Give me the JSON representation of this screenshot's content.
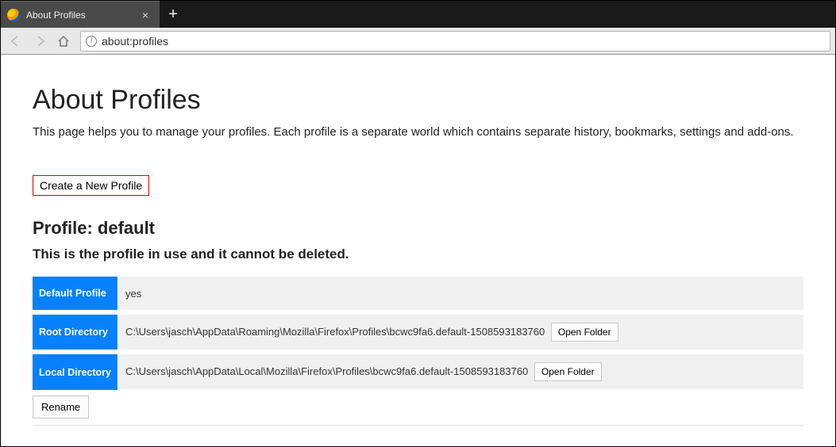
{
  "browser": {
    "tab_title": "About Profiles",
    "url": "about:profiles"
  },
  "page": {
    "heading": "About Profiles",
    "intro": "This page helps you to manage your profiles. Each profile is a separate world which contains separate history, bookmarks, settings and add-ons.",
    "create_button": "Create a New Profile",
    "profile": {
      "header": "Profile: default",
      "in_use_notice": "This is the profile in use and it cannot be deleted.",
      "rows": {
        "default_profile": {
          "label": "Default Profile",
          "value": "yes"
        },
        "root_dir": {
          "label": "Root Directory",
          "value": "C:\\Users\\jasch\\AppData\\Roaming\\Mozilla\\Firefox\\Profiles\\bcwc9fa6.default-1508593183760",
          "open": "Open Folder"
        },
        "local_dir": {
          "label": "Local Directory",
          "value": "C:\\Users\\jasch\\AppData\\Local\\Mozilla\\Firefox\\Profiles\\bcwc9fa6.default-1508593183760",
          "open": "Open Folder"
        }
      },
      "rename_button": "Rename"
    }
  }
}
